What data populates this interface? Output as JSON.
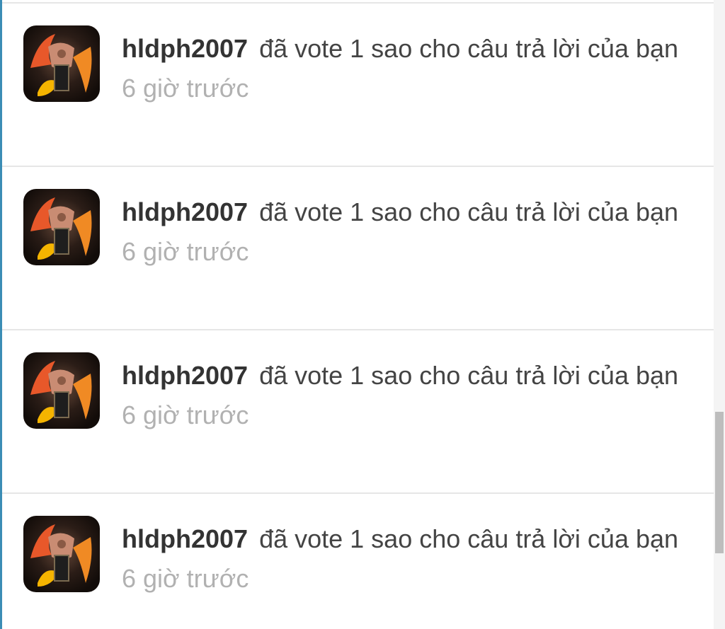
{
  "notifications": [
    {
      "username": "hldph2007",
      "message": "đã vote 1 sao cho câu trả lời của bạn",
      "time": "6 giờ trước",
      "avatar_icon": "fire-warrior-avatar"
    },
    {
      "username": "hldph2007",
      "message": "đã vote 1 sao cho câu trả lời của bạn",
      "time": "6 giờ trước",
      "avatar_icon": "fire-warrior-avatar"
    },
    {
      "username": "hldph2007",
      "message": "đã vote 1 sao cho câu trả lời của bạn",
      "time": "6 giờ trước",
      "avatar_icon": "fire-warrior-avatar"
    },
    {
      "username": "hldph2007",
      "message": "đã vote 1 sao cho câu trả lời của bạn",
      "time": "6 giờ trước",
      "avatar_icon": "fire-warrior-avatar"
    }
  ],
  "colors": {
    "accent_border": "#3b8db5",
    "divider": "#e6e6e6",
    "username": "#333333",
    "message": "#444444",
    "timestamp": "#b1b1b1"
  }
}
